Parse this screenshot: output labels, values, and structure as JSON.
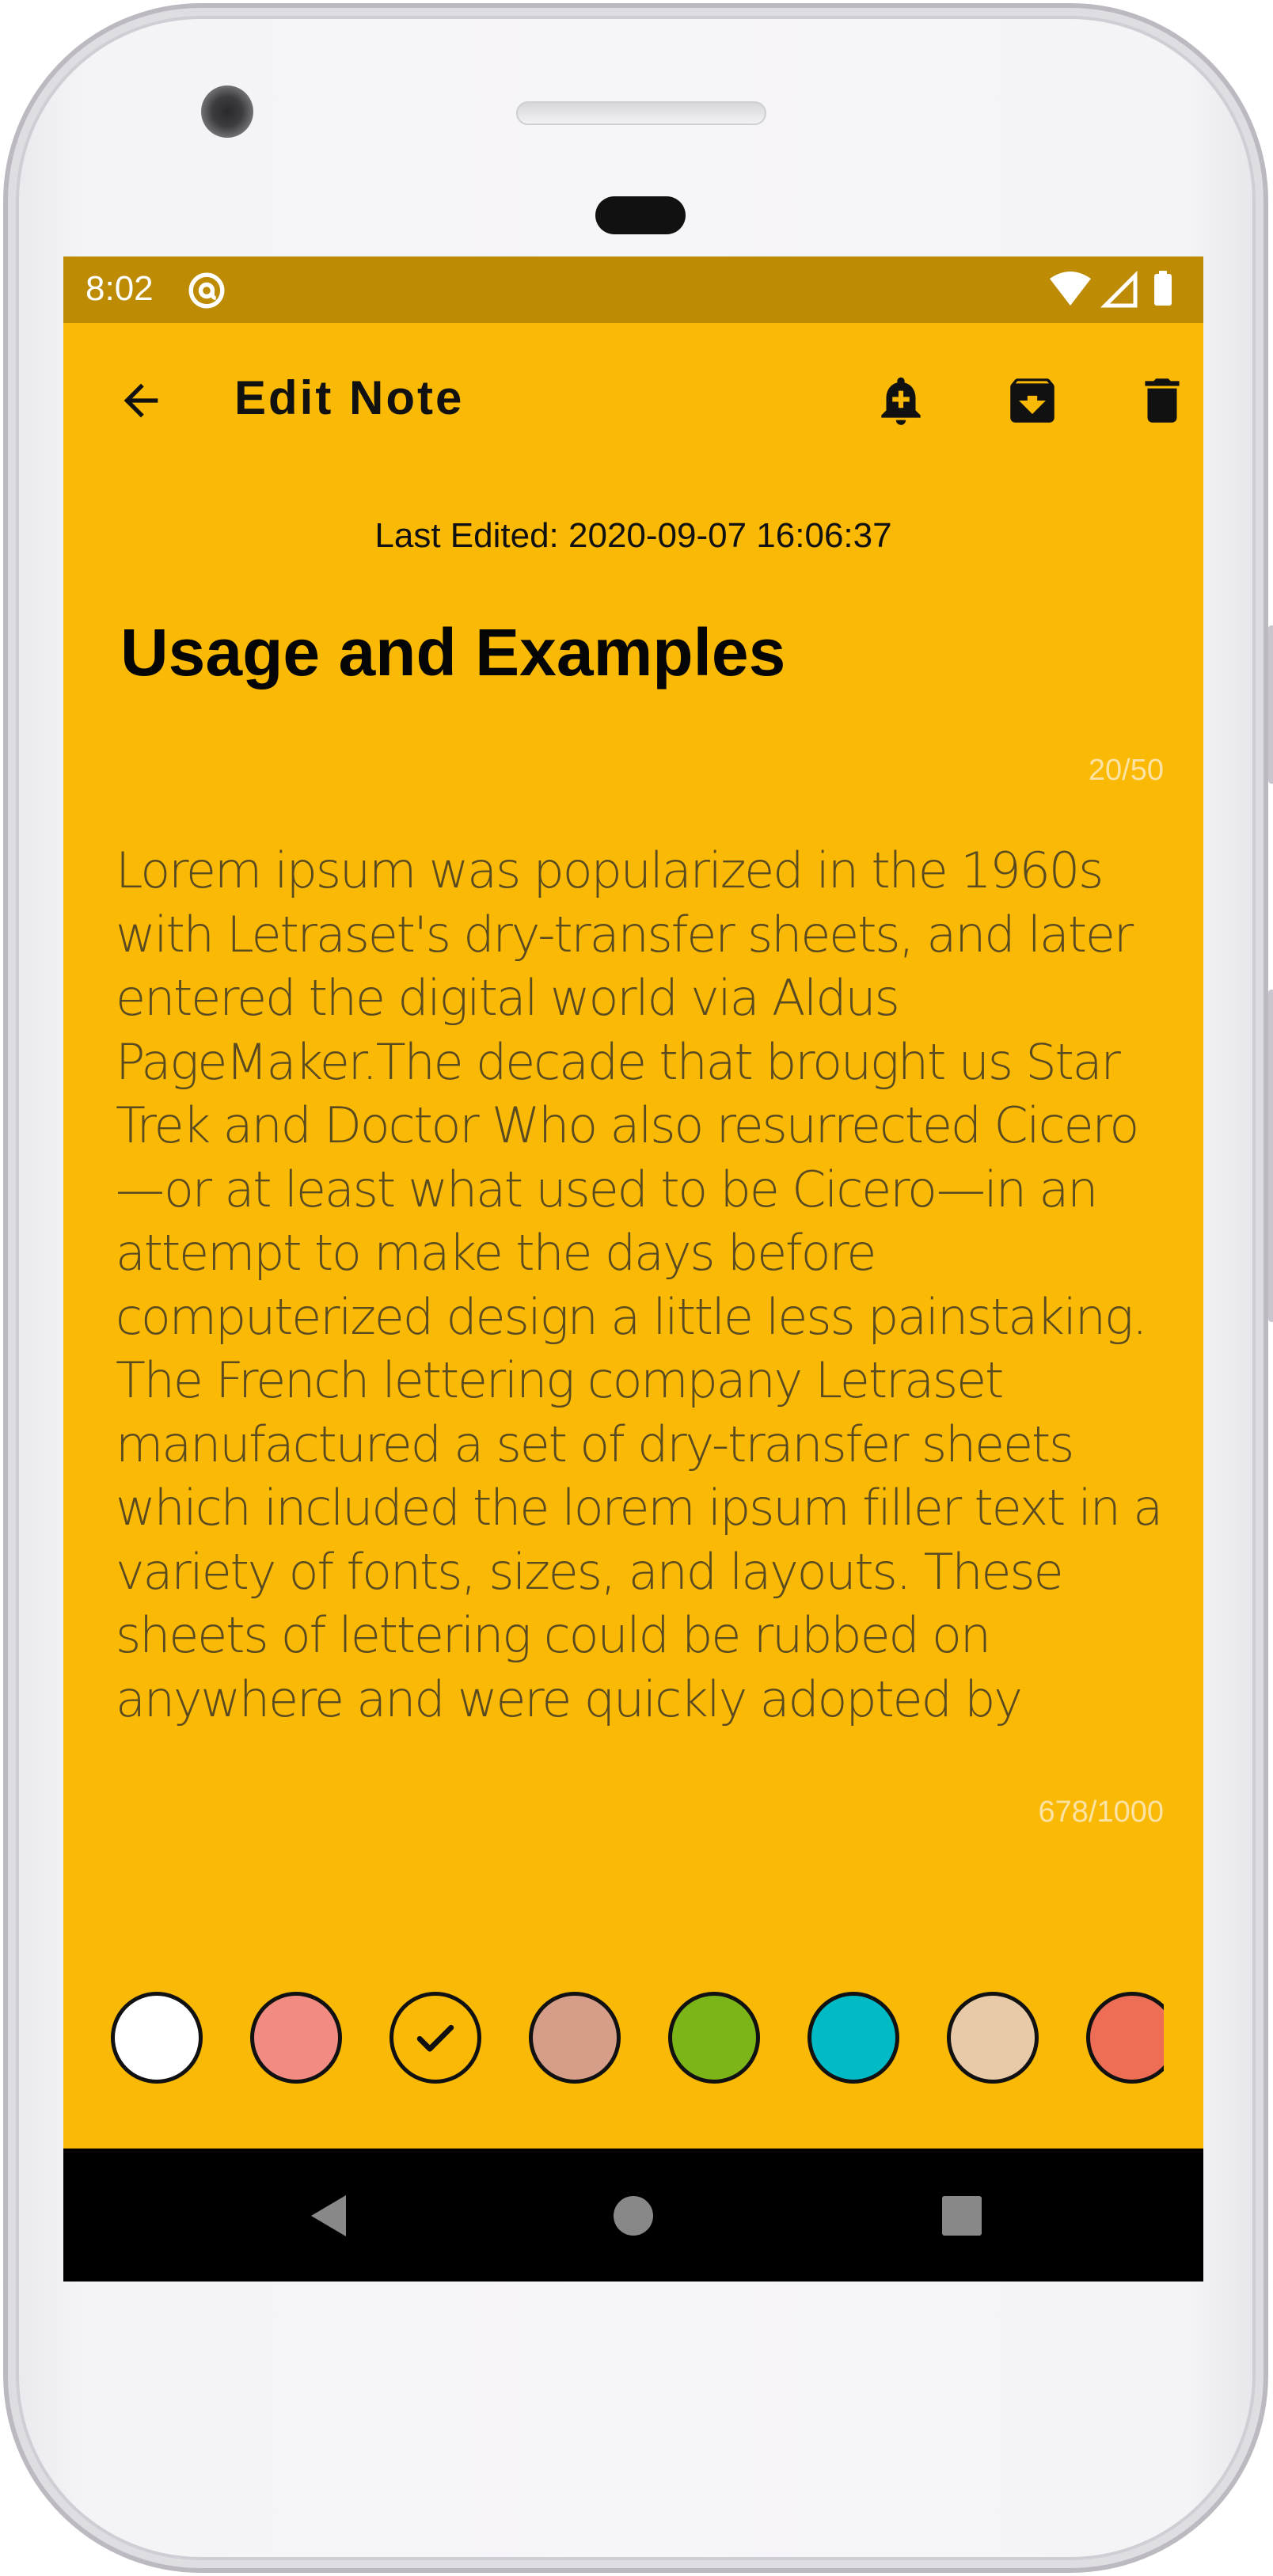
{
  "status_bar": {
    "time": "8:02",
    "background_color": "#bd8b04",
    "icons": [
      "at-sign-icon",
      "wifi-icon",
      "cell-signal-icon",
      "battery-icon"
    ]
  },
  "app_bar": {
    "title": "Edit Note",
    "back_icon": "arrow-back-icon",
    "actions": [
      {
        "name": "add-reminder",
        "icon": "bell-plus-icon"
      },
      {
        "name": "archive",
        "icon": "archive-box-icon"
      },
      {
        "name": "delete",
        "icon": "trash-icon"
      }
    ]
  },
  "note": {
    "last_edited": "Last Edited: 2020-09-07 16:06:37",
    "title": "Usage and Examples",
    "title_counter": "20/50",
    "body": "Lorem ipsum was popularized in the 1960s with Letraset's dry-transfer sheets, and later entered the digital world via Aldus PageMaker.The decade that brought us Star Trek and Doctor Who also resurrected Cicero—or at least what used to be Cicero—in an attempt to make the days before computerized design a little less painstaking. The French lettering company Letraset manufactured a set of dry-transfer sheets which included the lorem ipsum filler text in a variety of fonts, sizes, and layouts. These sheets of lettering could be rubbed on anywhere and were quickly adopted by",
    "body_counter": "678/1000",
    "background_color": "#f9b904"
  },
  "color_picker": {
    "selected_index": 2,
    "swatches": [
      "#ffffff",
      "#f28b82",
      "#f9b904",
      "#d69e89",
      "#7cb518",
      "#00bac6",
      "#e8c9a8",
      "#ee6d55"
    ]
  },
  "nav_bar": {
    "buttons": [
      "back-triangle-icon",
      "home-circle-icon",
      "recents-square-icon"
    ]
  }
}
